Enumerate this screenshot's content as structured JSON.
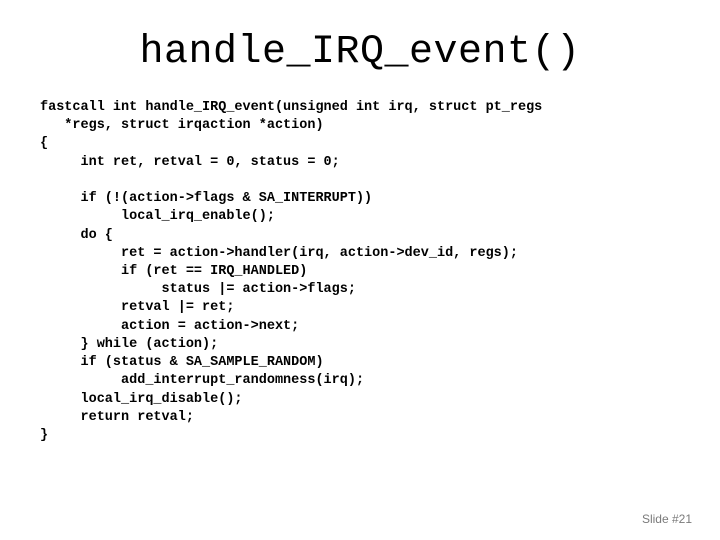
{
  "title": "handle_IRQ_event()",
  "code_lines": [
    "fastcall int handle_IRQ_event(unsigned int irq, struct pt_regs",
    "   *regs, struct irqaction *action)",
    "{",
    "     int ret, retval = 0, status = 0;",
    "",
    "     if (!(action->flags & SA_INTERRUPT))",
    "          local_irq_enable();",
    "     do {",
    "          ret = action->handler(irq, action->dev_id, regs);",
    "          if (ret == IRQ_HANDLED)",
    "               status |= action->flags;",
    "          retval |= ret;",
    "          action = action->next;",
    "     } while (action);",
    "     if (status & SA_SAMPLE_RANDOM)",
    "          add_interrupt_randomness(irq);",
    "     local_irq_disable();",
    "     return retval;",
    "}"
  ],
  "footer": "Slide #21"
}
